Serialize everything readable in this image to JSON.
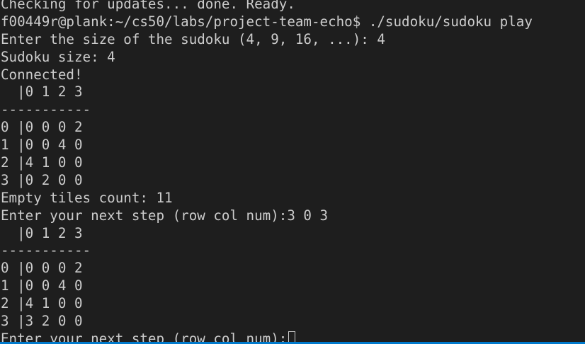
{
  "terminal": {
    "lines": [
      "Checking for updates... done. Ready.",
      "f00449r@plank:~/cs50/labs/project-team-echo$ ./sudoku/sudoku play",
      "Enter the size of the sudoku (4, 9, 16, ...): 4",
      "Sudoku size: 4",
      "Connected!",
      "  |0 1 2 3",
      "-----------",
      "0 |0 0 0 2",
      "1 |0 0 4 0",
      "2 |4 1 0 0",
      "3 |0 2 0 0",
      "Empty tiles count: 11",
      "Enter your next step (row col num):3 0 3",
      "  |0 1 2 3",
      "-----------",
      "0 |0 0 0 2",
      "1 |0 0 4 0",
      "2 |4 1 0 0",
      "3 |3 2 0 0"
    ],
    "prompt": "Enter your next step (row col num):"
  },
  "colors": {
    "background": "#1e1e1e",
    "foreground": "#cccccc",
    "status_bar": "#007acc"
  }
}
